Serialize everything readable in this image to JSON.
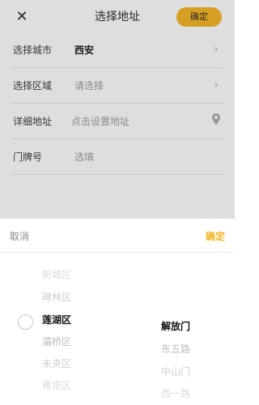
{
  "navbar": {
    "close_icon": "close-icon",
    "title": "选择地址",
    "confirm_label": "确定"
  },
  "form": {
    "city": {
      "label": "选择城市",
      "value": "西安"
    },
    "area": {
      "label": "选择区域",
      "placeholder": "请选择"
    },
    "address": {
      "label": "详细地址",
      "placeholder": "点击设置地址"
    },
    "door": {
      "label": "门牌号",
      "placeholder": "选填"
    }
  },
  "picker": {
    "cancel_label": "取消",
    "confirm_label": "确定",
    "districts": [
      "新城区",
      "碑林区",
      "莲湖区",
      "灞桥区",
      "未央区",
      "雁塔区"
    ],
    "selected_district_index": 2,
    "streets": [
      "解放门",
      "东五路",
      "中山门",
      "西一路"
    ],
    "selected_street_index": 0
  },
  "colors": {
    "accent": "#f4b21a",
    "placeholder": "#9a9a9a"
  }
}
